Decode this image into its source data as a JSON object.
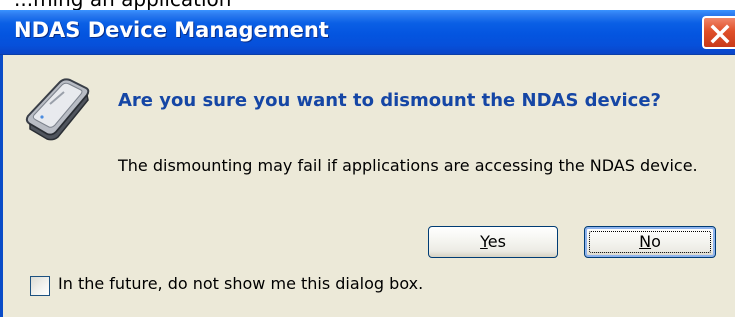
{
  "dialog": {
    "top_strip_text": "...ming an application",
    "title": "NDAS Device Management",
    "question": "Are you sure you want to dismount the NDAS device?",
    "message": "The dismounting may fail if applications are accessing the NDAS device.",
    "buttons": {
      "yes": {
        "label_first": "Y",
        "label_rest": "es",
        "mnemonic": "Y"
      },
      "no": {
        "label_first": "N",
        "label_rest": "o",
        "mnemonic": "N"
      }
    },
    "checkbox": {
      "label": "In the future, do not show me this dialog box.",
      "checked": false
    }
  },
  "icons": {
    "drive": "ndas-drive-icon",
    "close": "close-icon"
  },
  "colors": {
    "title_bar": "#0455E0",
    "dialog_bg": "#ECE9D8",
    "question_text": "#1546A5",
    "close_button": "#E0502A"
  }
}
